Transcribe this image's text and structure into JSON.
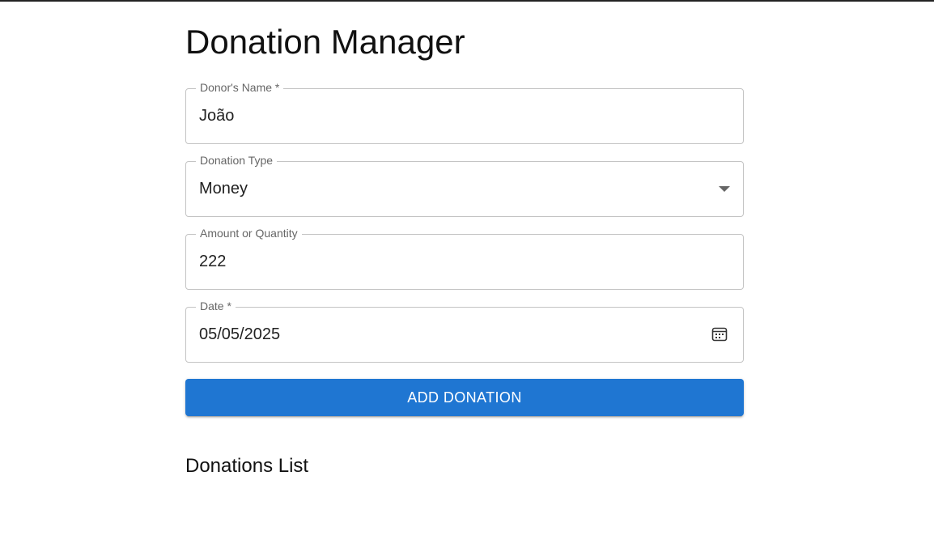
{
  "page": {
    "title": "Donation Manager"
  },
  "form": {
    "donor_name": {
      "label": "Donor's Name *",
      "value": "João"
    },
    "donation_type": {
      "label": "Donation Type",
      "value": "Money"
    },
    "amount": {
      "label": "Amount or Quantity",
      "value": "222"
    },
    "date": {
      "label": "Date *",
      "value": "05/05/2025"
    },
    "submit_label": "ADD DONATION"
  },
  "list": {
    "title": "Donations List"
  },
  "icons": {
    "dropdown": "chevron-down-icon",
    "date": "calendar-icon"
  },
  "colors": {
    "primary": "#1f76d2",
    "border": "#c4c4c4",
    "label": "#666666"
  }
}
